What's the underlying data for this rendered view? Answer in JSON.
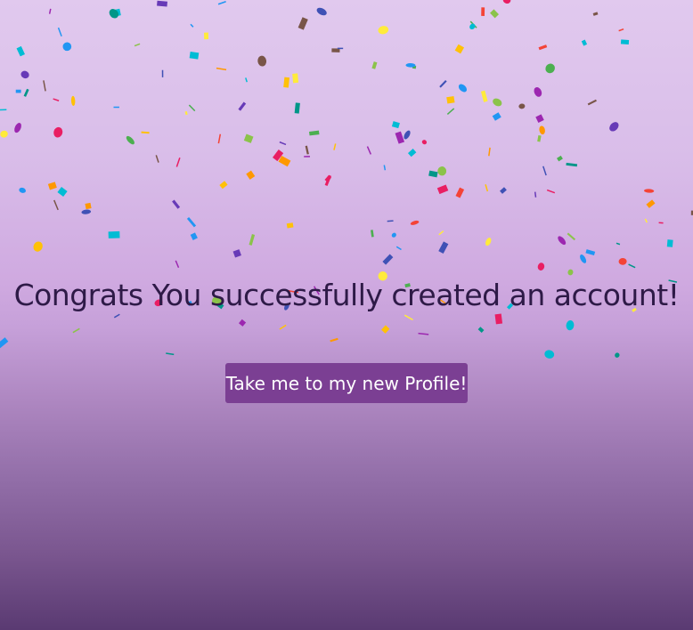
{
  "page": {
    "title": "Congrats You successfully created an account!",
    "button_label": "Take me to my new Profile!"
  },
  "confetti": {
    "name": "confetti-decoration",
    "colors": [
      "#e91e63",
      "#2196f3",
      "#ff9800",
      "#8bc34a",
      "#9c27b0",
      "#ffeb3b",
      "#00bcd4",
      "#f44336",
      "#4caf50",
      "#3f51b5",
      "#009688",
      "#ffc107",
      "#795548",
      "#673ab7"
    ]
  }
}
